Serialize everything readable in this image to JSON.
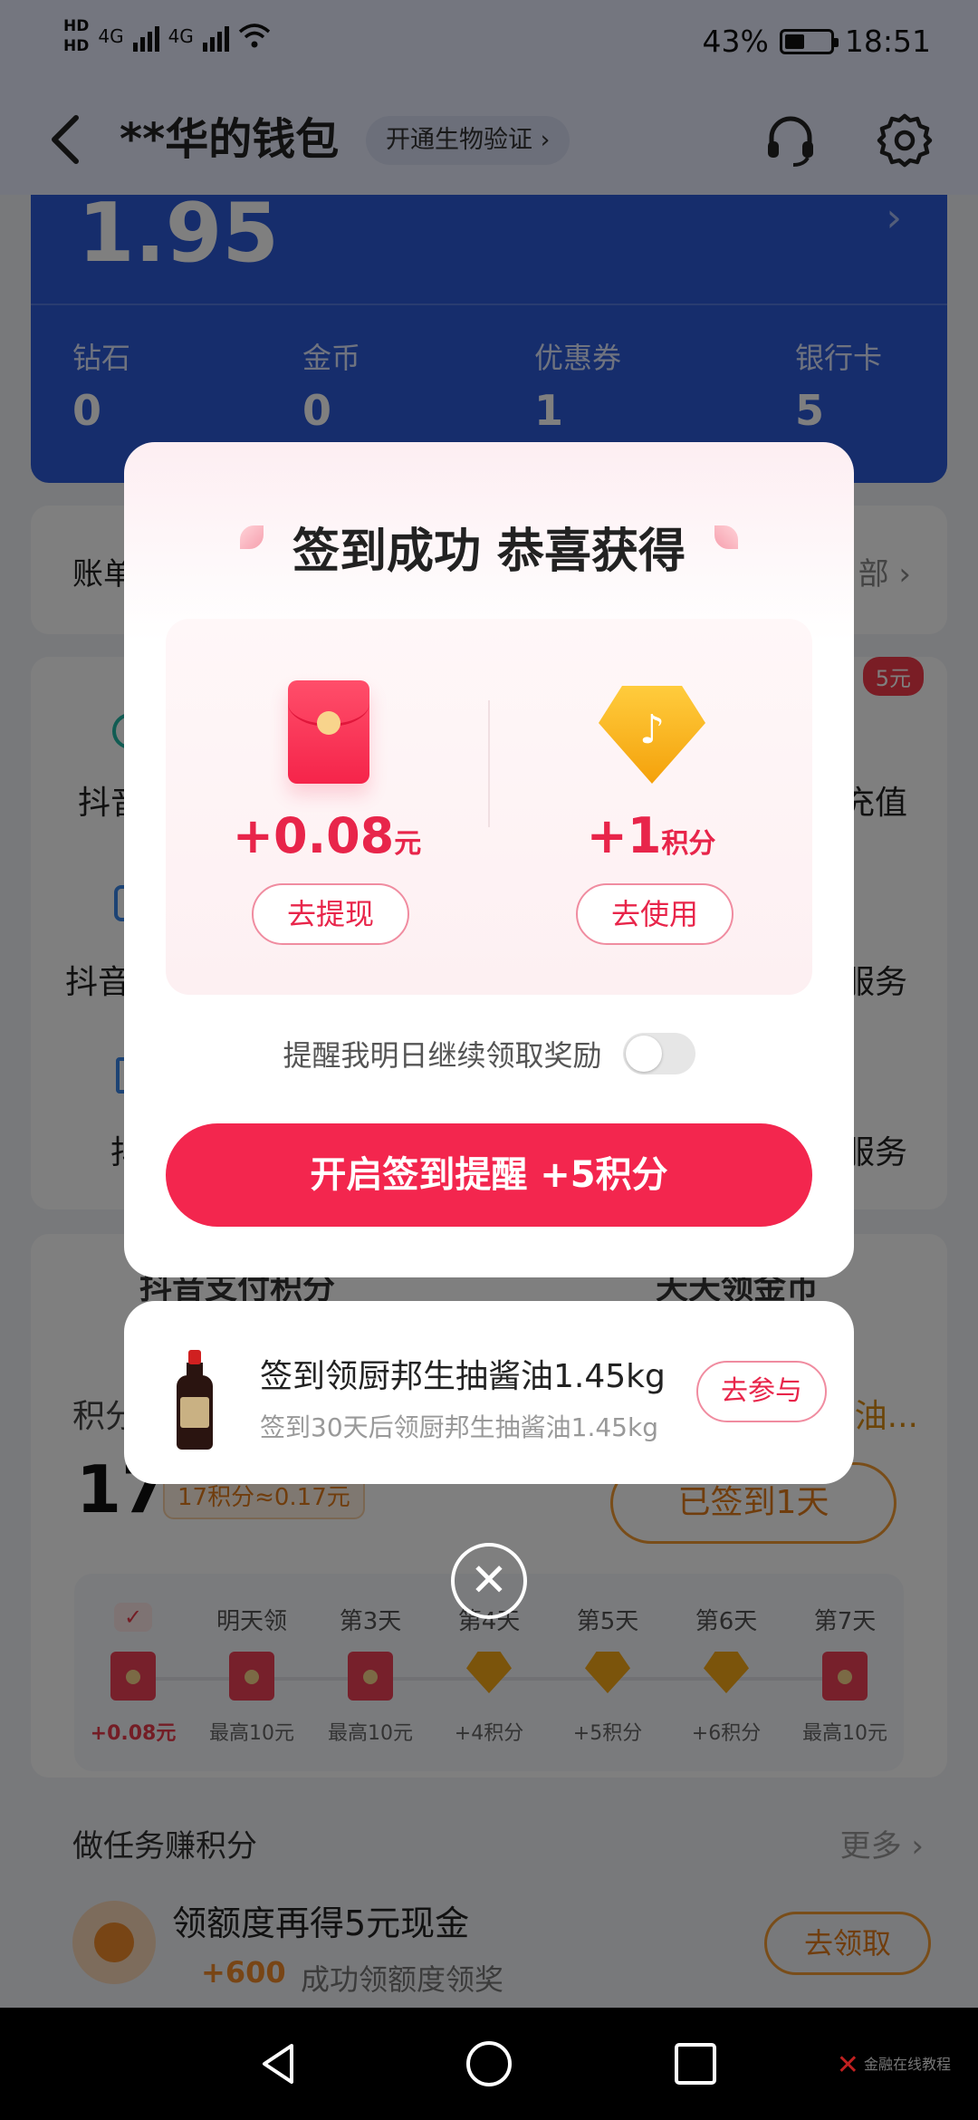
{
  "status_bar": {
    "network_left": "HD",
    "network_label_1": "4G",
    "network_label_2": "4G",
    "battery_percent": "43%",
    "time": "18:51"
  },
  "header": {
    "title": "**华的钱包",
    "bio_button": "开通生物验证 ›"
  },
  "balance": {
    "amount": "1.95",
    "stats": [
      {
        "label": "钻石",
        "value": "0"
      },
      {
        "label": "金币",
        "value": "0"
      },
      {
        "label": "优惠券",
        "value": "1"
      },
      {
        "label": "银行卡",
        "value": "5"
      }
    ]
  },
  "bill": {
    "label": "账单",
    "right": "部 ›"
  },
  "services": {
    "badge": "5元",
    "labels": [
      "抖音",
      "充值",
      "抖音",
      "服务",
      "抖",
      "服务"
    ]
  },
  "points": {
    "tabs": [
      "抖音支付积分",
      "天天领金币"
    ],
    "label": "积分",
    "right_text": "油...",
    "number": "17",
    "equiv": "17积分≈0.17元",
    "signed_button": "已签到1天",
    "days": [
      {
        "label": "✓",
        "reward": "+0.08元",
        "kind": "red",
        "current": true
      },
      {
        "label": "明天领",
        "reward": "最高10元",
        "kind": "red"
      },
      {
        "label": "第3天",
        "reward": "最高10元",
        "kind": "red"
      },
      {
        "label": "第4天",
        "reward": "+4积分",
        "kind": "gold"
      },
      {
        "label": "第5天",
        "reward": "+5积分",
        "kind": "gold"
      },
      {
        "label": "第6天",
        "reward": "+6积分",
        "kind": "gold"
      },
      {
        "label": "第7天",
        "reward": "最高10元",
        "kind": "red"
      }
    ]
  },
  "tasks": {
    "title": "做任务赚积分",
    "more": "更多 ›",
    "item": {
      "title": "领额度再得5元现金",
      "points": "+600",
      "desc": "成功领额度领奖",
      "button": "去领取"
    }
  },
  "modal": {
    "title": "签到成功 恭喜获得",
    "cash": {
      "amount": "+0.08",
      "unit": "元",
      "button": "去提现"
    },
    "points": {
      "amount": "+1",
      "unit": "积分",
      "button": "去使用"
    },
    "remind_text": "提醒我明日继续领取奖励",
    "cta": "开启签到提醒 +5积分"
  },
  "promo": {
    "title": "签到领厨邦生抽酱油1.45kg",
    "subtitle": "签到30天后领厨邦生抽酱油1.45kg",
    "button": "去参与"
  },
  "close_symbol": "✕",
  "watermark": "金融在线教程",
  "colors": {
    "accent_red": "#f3264e",
    "balance_blue": "#2d5bd9",
    "gold": "#f4a10b"
  }
}
